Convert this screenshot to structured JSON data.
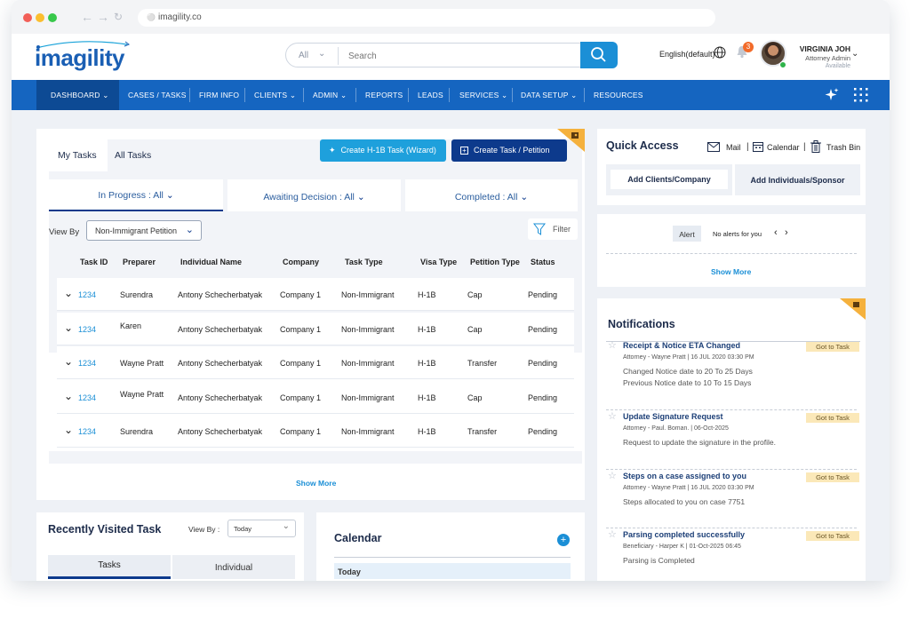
{
  "browser": {
    "url": "imagility.co"
  },
  "header": {
    "logo": "imagility",
    "search": {
      "category": "All",
      "placeholder": "Search"
    },
    "language": "English(default)",
    "notification_count": "3",
    "user": {
      "name": "VIRGINIA JOH",
      "role": "Attorney Admin",
      "status": "Available"
    }
  },
  "nav": [
    "DASHBOARD",
    "CASES / TASKS",
    "FIRM INFO",
    "CLIENTS",
    "ADMIN",
    "REPORTS",
    "LEADS",
    "SERVICES",
    "DATA SETUP",
    "RESOURCES"
  ],
  "tasks_panel": {
    "tabs": [
      "My Tasks",
      "All Tasks"
    ],
    "create_h1b": "Create H-1B Task (Wizard)",
    "create_task": "Create Task / Petition",
    "status_tabs": [
      "In Progress : All",
      "Awaiting Decision : All",
      "Completed : All"
    ],
    "view_by_label": "View By",
    "view_by_value": "Non-Immigrant Petition",
    "filter": "Filter",
    "columns": [
      "Task ID",
      "Preparer",
      "Individual Name",
      "Company",
      "Task Type",
      "Visa Type",
      "Petition Type",
      "Status"
    ],
    "rows": [
      [
        "1234",
        "Surendra",
        "Antony Schecherbatyak",
        "Company 1",
        "Non-Immigrant",
        "H-1B",
        "Cap",
        "Pending"
      ],
      [
        "1234",
        "Karen",
        "Antony Schecherbatyak",
        "Company 1",
        "Non-Immigrant",
        "H-1B",
        "Cap",
        "Pending"
      ],
      [
        "1234",
        "Wayne Pratt",
        "Antony Schecherbatyak",
        "Company 1",
        "Non-Immigrant",
        "H-1B",
        "Transfer",
        "Pending"
      ],
      [
        "1234",
        "Wayne Pratt",
        "Antony Schecherbatyak",
        "Company 1",
        "Non-Immigrant",
        "H-1B",
        "Cap",
        "Pending"
      ],
      [
        "1234",
        "Surendra",
        "Antony Schecherbatyak",
        "Company 1",
        "Non-Immigrant",
        "H-1B",
        "Transfer",
        "Pending"
      ]
    ],
    "show_more": "Show More"
  },
  "recent": {
    "title": "Recently Visited Task",
    "view_by_label": "View By :",
    "view_by_value": "Today",
    "tabs": [
      "Tasks",
      "Individual"
    ]
  },
  "calendar": {
    "title": "Calendar",
    "today": "Today"
  },
  "quick_access": {
    "title": "Quick Access",
    "links": [
      "Mail",
      "Calendar",
      "Trash Bin"
    ],
    "buttons": [
      "Add Clients/Company",
      "Add Individuals/Sponsor"
    ]
  },
  "alerts": {
    "tab": "Alert",
    "message": "No alerts for you",
    "show_more": "Show More"
  },
  "notifications": {
    "title": "Notifications",
    "action": "Got to Task",
    "items": [
      {
        "title": "Receipt & Notice ETA Changed",
        "meta": "Attorney - Wayne Pratt | 16 JUL 2020 03:30 PM",
        "lines": [
          "Changed Notice date to 20 To 25 Days",
          "Previous Notice date to 10 To 15 Days"
        ]
      },
      {
        "title": "Update Signature Request",
        "meta": "Attorney - Paul. Boman. | 06-Oct-2025",
        "lines": [
          "Request to update the signature in the profile."
        ]
      },
      {
        "title": "Steps on a case assigned to you",
        "meta": "Attorney - Wayne Pratt | 16 JUL 2020 03:30 PM",
        "lines": [
          "Steps allocated to you on case 7751"
        ]
      },
      {
        "title": "Parsing completed successfully",
        "meta": "Beneficiary - Harper K | 01-Oct-2025 06:45",
        "lines": [
          "Parsing is Completed"
        ]
      }
    ]
  },
  "colors": {
    "brand_blue": "#1565c0",
    "accent_cyan": "#1b8fd6",
    "navy_button": "#0d3a8c",
    "badge_orange": "#f26b2a"
  }
}
